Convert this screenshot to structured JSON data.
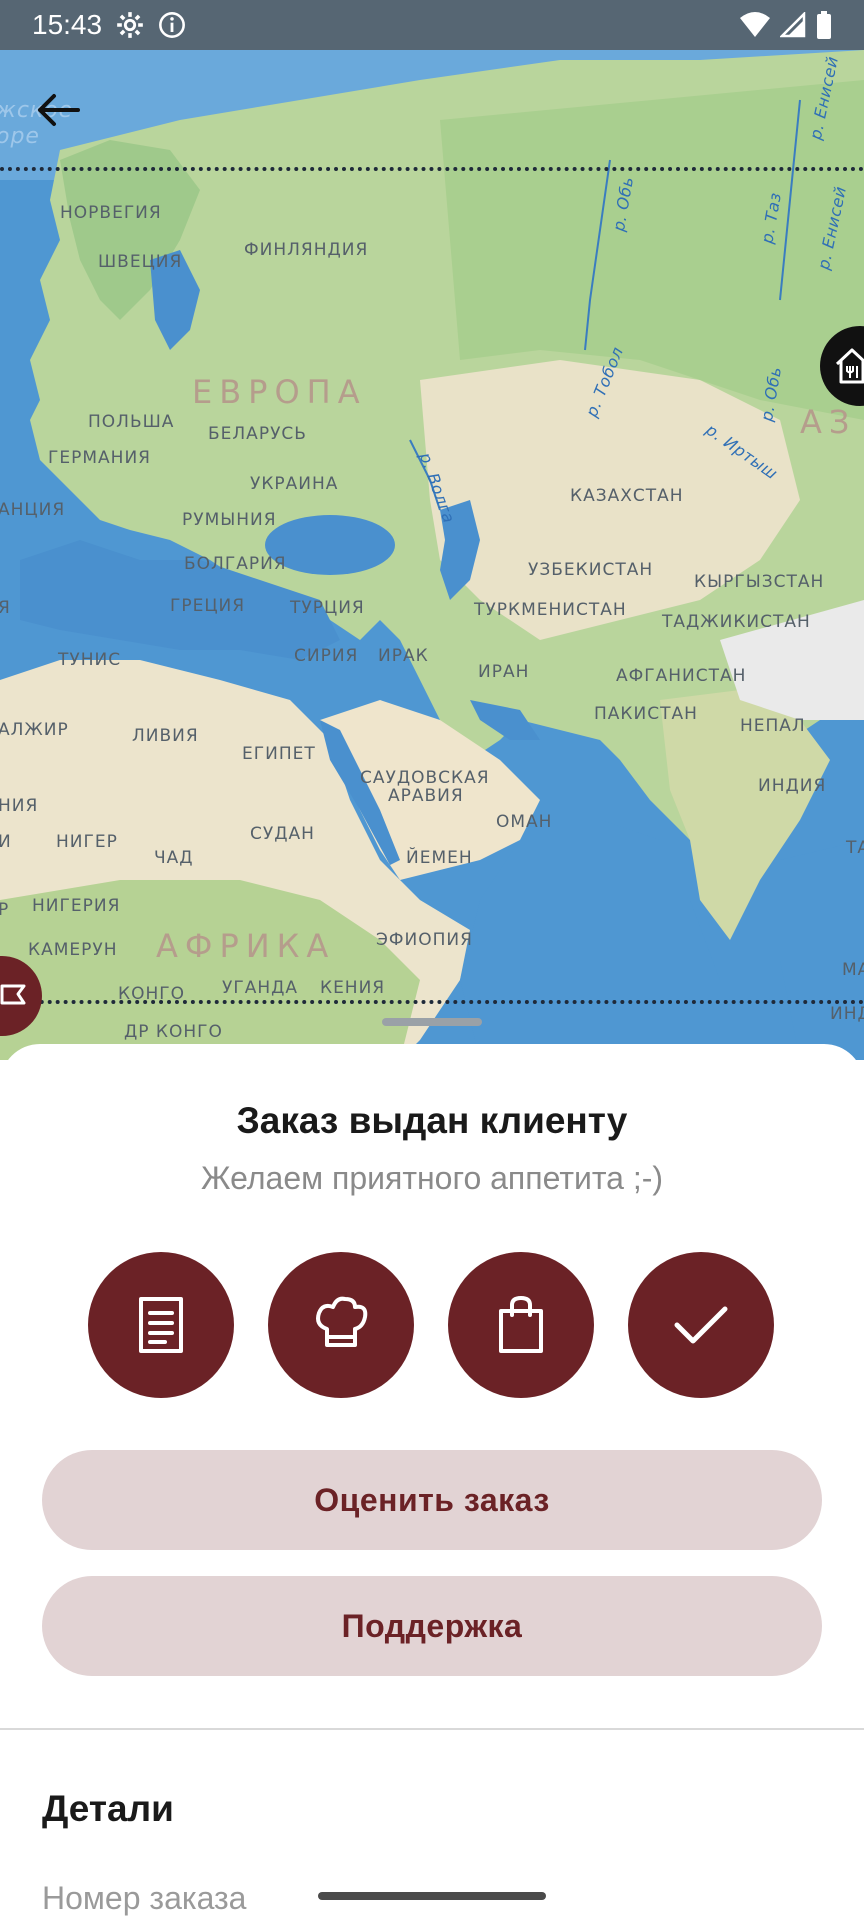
{
  "status_bar": {
    "time": "15:43"
  },
  "map": {
    "labels": {
      "norway": "НОРВЕГИЯ",
      "sweden": "ШВЕЦИЯ",
      "finland": "ФИНЛЯНДИЯ",
      "europe": "ЕВРОПА",
      "poland": "ПОЛЬША",
      "belarus": "БЕЛАРУСЬ",
      "germany": "ГЕРМАНИЯ",
      "ukraine": "УКРАИНА",
      "france_partial": "АНЦИЯ",
      "romania": "РУМЫНИЯ",
      "bulgaria": "БОЛГАРИЯ",
      "greece": "ГРЕЦИЯ",
      "turkey": "ТУРЦИЯ",
      "syria": "СИРИЯ",
      "iraq": "ИРАК",
      "iran": "ИРАН",
      "tunisia": "ТУНИС",
      "algeria_partial": "АЛЖИР",
      "libya": "ЛИВИЯ",
      "egypt": "ЕГИПЕТ",
      "saudi_arabia_1": "САУДОВСКАЯ",
      "saudi_arabia_2": "АРАВИЯ",
      "oman": "ОМАН",
      "yemen": "ЙЕМЕН",
      "sudan": "СУДАН",
      "niger": "НИГЕР",
      "chad": "ЧАД",
      "nigeria": "НИГЕРИЯ",
      "cameroon": "КАМЕРУН",
      "africa": "АФРИКА",
      "ethiopia": "ЭФИОПИЯ",
      "uganda": "УГАНДА",
      "kenya": "КЕНИЯ",
      "congo": "КОНГО",
      "dr_congo": "ДР КОНГО",
      "kazakhstan": "КАЗАХСТАН",
      "uzbekistan": "УЗБЕКИСТАН",
      "kyrgyzstan": "КЫРГЫЗСТАН",
      "turkmenistan": "ТУРКМЕНИСТАН",
      "tajikistan": "ТАДЖИКИСТАН",
      "afghanistan": "АФГАНИСТАН",
      "pakistan": "ПАКИСТАН",
      "nepal": "НЕПАЛ",
      "india": "ИНДИЯ",
      "asia_partial": "АЗ",
      "river_volga": "р. Волга",
      "river_tobol": "р. Тобол",
      "river_irtysh": "р. Иртыш",
      "river_ob_1": "р. Обь",
      "river_ob_2": "р. Обь",
      "river_taz": "р. Таз",
      "river_yenisei_1": "р. Енисей",
      "river_yenisei_2": "р. Енисей",
      "sea_partial_1": "жское",
      "sea_partial_2": "оре",
      "edge_nia": "НИЯ",
      "edge_i": "И",
      "edge_ya": "Я",
      "edge_r": "Р",
      "edge_ta": "ТА",
      "edge_ma": "МА",
      "edge_ind": "ИНД"
    }
  },
  "sheet": {
    "title": "Заказ выдан клиенту",
    "subtitle": "Желаем приятного аппетита ;-)",
    "steps": [
      {
        "icon": "receipt-icon"
      },
      {
        "icon": "chef-hat-icon"
      },
      {
        "icon": "shopping-bag-icon"
      },
      {
        "icon": "check-icon"
      }
    ],
    "rate_order_label": "Оценить заказ",
    "support_label": "Поддержка",
    "details_heading": "Детали",
    "order_number_label": "Номер заказа"
  },
  "colors": {
    "accent": "#6b2226",
    "button_bg": "#e2d3d4",
    "ocean": "#4a93cf",
    "land": "#e9e4d3"
  }
}
